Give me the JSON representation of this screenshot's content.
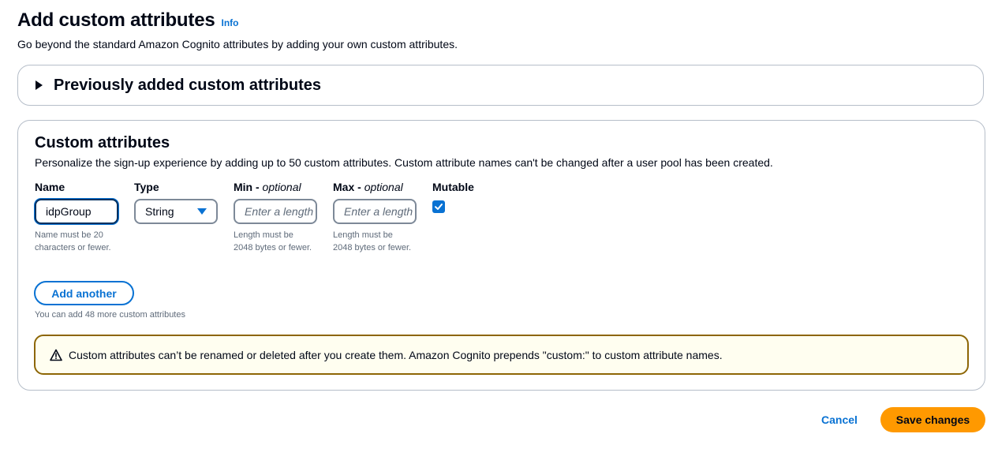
{
  "header": {
    "title": "Add custom attributes",
    "info": "Info",
    "description": "Go beyond the standard Amazon Cognito attributes by adding your own custom attributes."
  },
  "expander": {
    "label": "Previously added custom attributes",
    "icon": "caret-right-icon"
  },
  "section": {
    "title": "Custom attributes",
    "description": "Personalize the sign-up experience by adding up to 50 custom attributes. Custom attribute names can't be changed after a user pool has been created."
  },
  "fields": {
    "name": {
      "label": "Name",
      "value": "idpGroup",
      "hint": "Name must be 20 characters or fewer."
    },
    "type": {
      "label": "Type",
      "value": "String"
    },
    "min": {
      "label": "Min - ",
      "optional": "optional",
      "placeholder": "Enter a length",
      "hint": "Length must be 2048 bytes or fewer."
    },
    "max": {
      "label": "Max - ",
      "optional": "optional",
      "placeholder": "Enter a length",
      "hint": "Length must be 2048 bytes or fewer."
    },
    "mutable": {
      "label": "Mutable",
      "checked": true
    }
  },
  "add_another": {
    "label": "Add another",
    "hint": "You can add 48 more custom attributes"
  },
  "alert": {
    "icon": "warning-icon",
    "text": "Custom attributes can’t be renamed or deleted after you create them. Amazon Cognito prepends \"custom:\" to custom attribute names."
  },
  "actions": {
    "cancel": "Cancel",
    "save": "Save changes"
  },
  "colors": {
    "accent": "#0972d3",
    "primary_button": "#ff9900",
    "warning_border": "#8d6605"
  }
}
